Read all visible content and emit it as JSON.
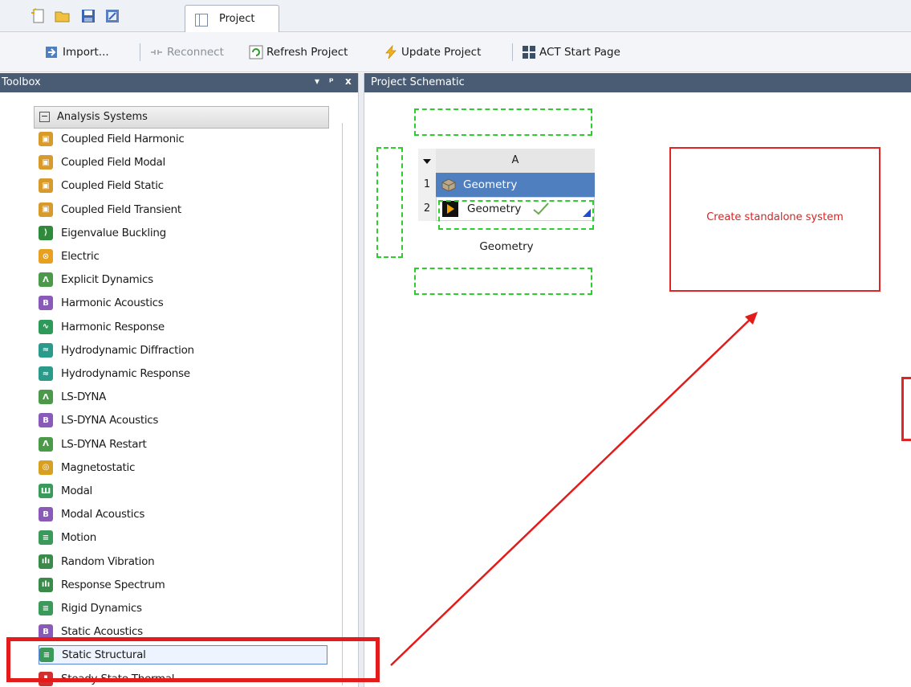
{
  "tabs": {
    "project_label": "Project"
  },
  "toolbar": {
    "import_label": "Import...",
    "reconnect_label": "Reconnect",
    "refresh_label": "Refresh Project",
    "update_label": "Update Project",
    "act_label": "ACT Start Page"
  },
  "toolbox": {
    "title": "Toolbox",
    "pin_glyph": "▾",
    "dock_glyph": "ᵖ",
    "close_glyph": "x",
    "group_label": "Analysis Systems",
    "items": [
      {
        "label": "Coupled Field Harmonic",
        "icon": "coupled-field-icon"
      },
      {
        "label": "Coupled Field Modal",
        "icon": "coupled-field-icon"
      },
      {
        "label": "Coupled Field Static",
        "icon": "coupled-field-icon"
      },
      {
        "label": "Coupled Field Transient",
        "icon": "coupled-field-icon"
      },
      {
        "label": "Eigenvalue Buckling",
        "icon": "eigenvalue-buckling-icon"
      },
      {
        "label": "Electric",
        "icon": "electric-icon"
      },
      {
        "label": "Explicit Dynamics",
        "icon": "explicit-dynamics-icon"
      },
      {
        "label": "Harmonic Acoustics",
        "icon": "acoustics-icon"
      },
      {
        "label": "Harmonic Response",
        "icon": "harmonic-response-icon"
      },
      {
        "label": "Hydrodynamic Diffraction",
        "icon": "hydrodynamic-icon"
      },
      {
        "label": "Hydrodynamic Response",
        "icon": "hydrodynamic-icon"
      },
      {
        "label": "LS-DYNA",
        "icon": "ls-dyna-icon"
      },
      {
        "label": "LS-DYNA Acoustics",
        "icon": "acoustics-icon"
      },
      {
        "label": "LS-DYNA Restart",
        "icon": "ls-dyna-icon"
      },
      {
        "label": "Magnetostatic",
        "icon": "magnetostatic-icon"
      },
      {
        "label": "Modal",
        "icon": "modal-icon"
      },
      {
        "label": "Modal Acoustics",
        "icon": "acoustics-icon"
      },
      {
        "label": "Motion",
        "icon": "motion-icon"
      },
      {
        "label": "Random Vibration",
        "icon": "spectrum-icon"
      },
      {
        "label": "Response Spectrum",
        "icon": "spectrum-icon"
      },
      {
        "label": "Rigid Dynamics",
        "icon": "motion-icon"
      },
      {
        "label": "Static Acoustics",
        "icon": "acoustics-icon"
      },
      {
        "label": "Static Structural",
        "icon": "static-structural-icon"
      },
      {
        "label": "Steady-State Thermal",
        "icon": "thermal-icon"
      }
    ]
  },
  "schematic": {
    "title": "Project Schematic",
    "system": {
      "column_header": "A",
      "rows": [
        {
          "num": "1",
          "label": "Geometry"
        },
        {
          "num": "2",
          "label": "Geometry"
        }
      ],
      "caption": "Geometry"
    },
    "drop_target_label": "Create standalone system"
  },
  "colors": {
    "panel_header": "#4a5c73",
    "highlight_red": "#e31b1b",
    "drop_zone_green": "#2ecc2e",
    "selected_row_blue": "#4f7fbf"
  }
}
